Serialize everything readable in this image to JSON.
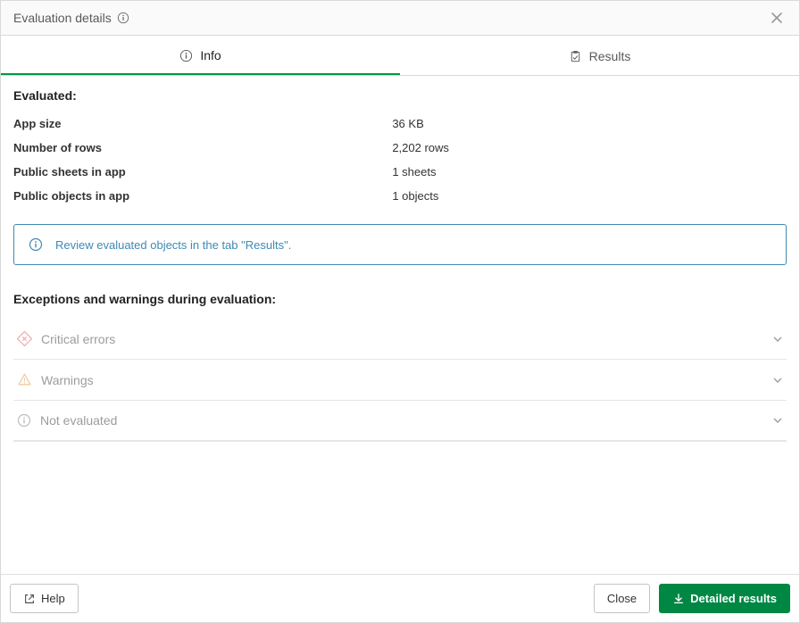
{
  "header": {
    "title": "Evaluation details"
  },
  "tabs": {
    "info": "Info",
    "results": "Results"
  },
  "evaluated": {
    "heading": "Evaluated:",
    "rows": [
      {
        "key": "App size",
        "value": "36 KB"
      },
      {
        "key": "Number of rows",
        "value": "2,202 rows"
      },
      {
        "key": "Public sheets in app",
        "value": "1 sheets"
      },
      {
        "key": "Public objects in app",
        "value": "1 objects"
      }
    ]
  },
  "notice": {
    "text": "Review evaluated objects in the tab \"Results\"."
  },
  "exceptions": {
    "heading": "Exceptions and warnings during evaluation:",
    "items": [
      {
        "label": "Critical errors",
        "icon": "critical"
      },
      {
        "label": "Warnings",
        "icon": "warning"
      },
      {
        "label": "Not evaluated",
        "icon": "info"
      }
    ]
  },
  "footer": {
    "help": "Help",
    "close": "Close",
    "detailed": "Detailed results"
  }
}
